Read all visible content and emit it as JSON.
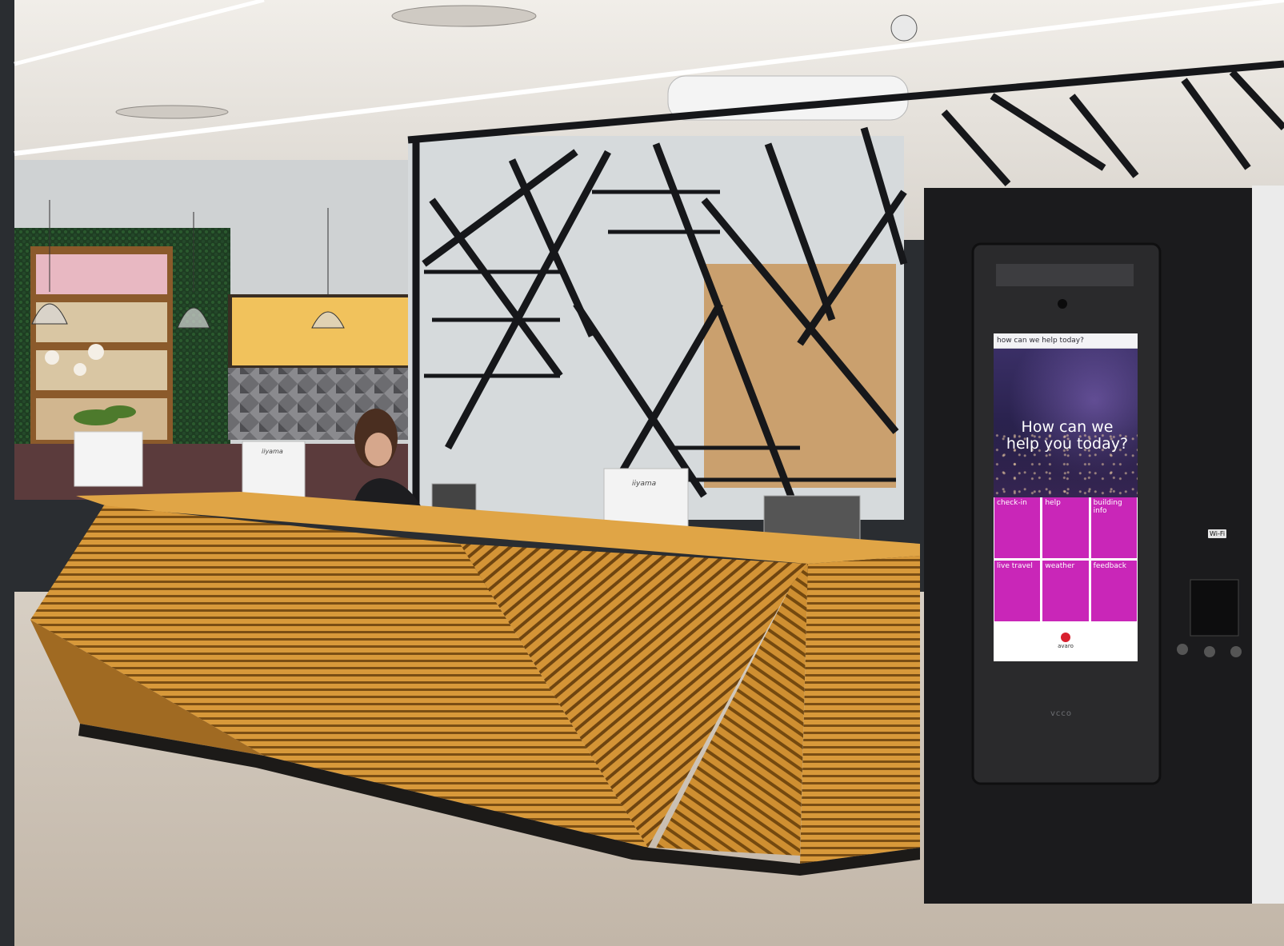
{
  "scene": {
    "description_labels": {
      "monitor_brand_left": "iiyama",
      "monitor_brand_right": "iiyama",
      "kiosk_brand": "vcco",
      "wifi_sticker": "Wi-Fi"
    },
    "colors": {
      "wall_dark": "#2a2d31",
      "ceiling": "#eeebe6",
      "floor": "#c9bfb2",
      "desk_wood": "#c98a2e",
      "desk_wood_dark": "#8a5a17",
      "kiosk_body": "#1c1c1e",
      "kiosk_accent": "#c926b8"
    }
  },
  "kiosk": {
    "topbar": "how can we help today?",
    "hero_line1": "How can we",
    "hero_line2": "help you today?",
    "tiles": [
      "check-in",
      "help",
      "building info",
      "live travel",
      "weather",
      "feedback"
    ],
    "logo_text": "avaro"
  }
}
